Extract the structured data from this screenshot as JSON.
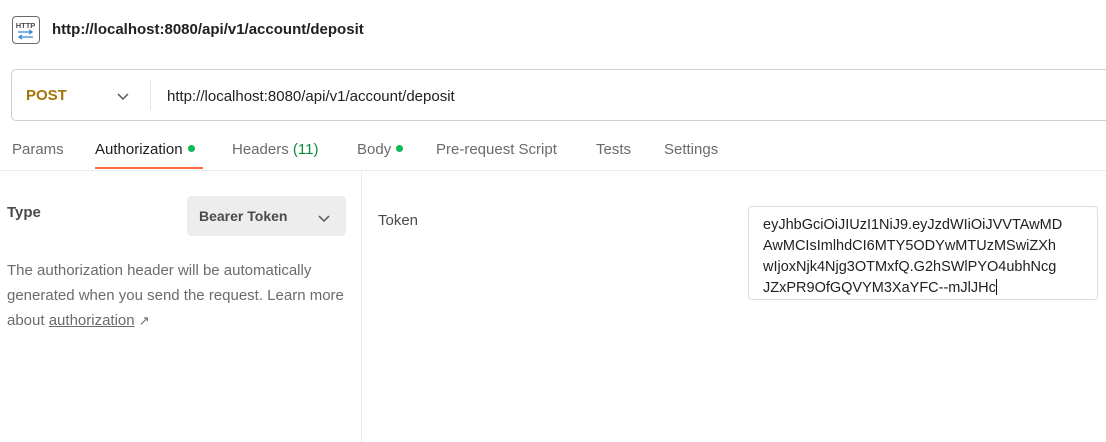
{
  "header": {
    "title": "http://localhost:8080/api/v1/account/deposit",
    "icon": "http-icon"
  },
  "request": {
    "method": "POST",
    "url": "http://localhost:8080/api/v1/account/deposit"
  },
  "tabs": [
    {
      "label": "Params"
    },
    {
      "label": "Authorization",
      "dot": true,
      "active": true
    },
    {
      "label": "Headers",
      "count": "(11)"
    },
    {
      "label": "Body",
      "dot": true
    },
    {
      "label": "Pre-request Script"
    },
    {
      "label": "Tests"
    },
    {
      "label": "Settings"
    }
  ],
  "auth": {
    "type_label": "Type",
    "type_value": "Bearer Token",
    "help_text": "The authorization header will be automatically generated when you send the request. Learn more about ",
    "help_link": "authorization",
    "help_arrow": "↗",
    "token_label": "Token",
    "token_lines": [
      "eyJhbGciOiJIUzI1NiJ9.eyJzdWIiOiJVVTAwMD",
      "AwMCIsImlhdCI6MTY5ODYwMTUzMSwiZXh",
      "wIjoxNjk4Njg3OTMxfQ.G2hSWlPYO4ubhNcg",
      "JZxPR9OfGQVYM3XaYFC--mJlJHc"
    ]
  },
  "colors": {
    "method": "#a5750b",
    "accent": "#ff6c37",
    "dot": "#0cbb52",
    "count": "#0f8a3a"
  }
}
